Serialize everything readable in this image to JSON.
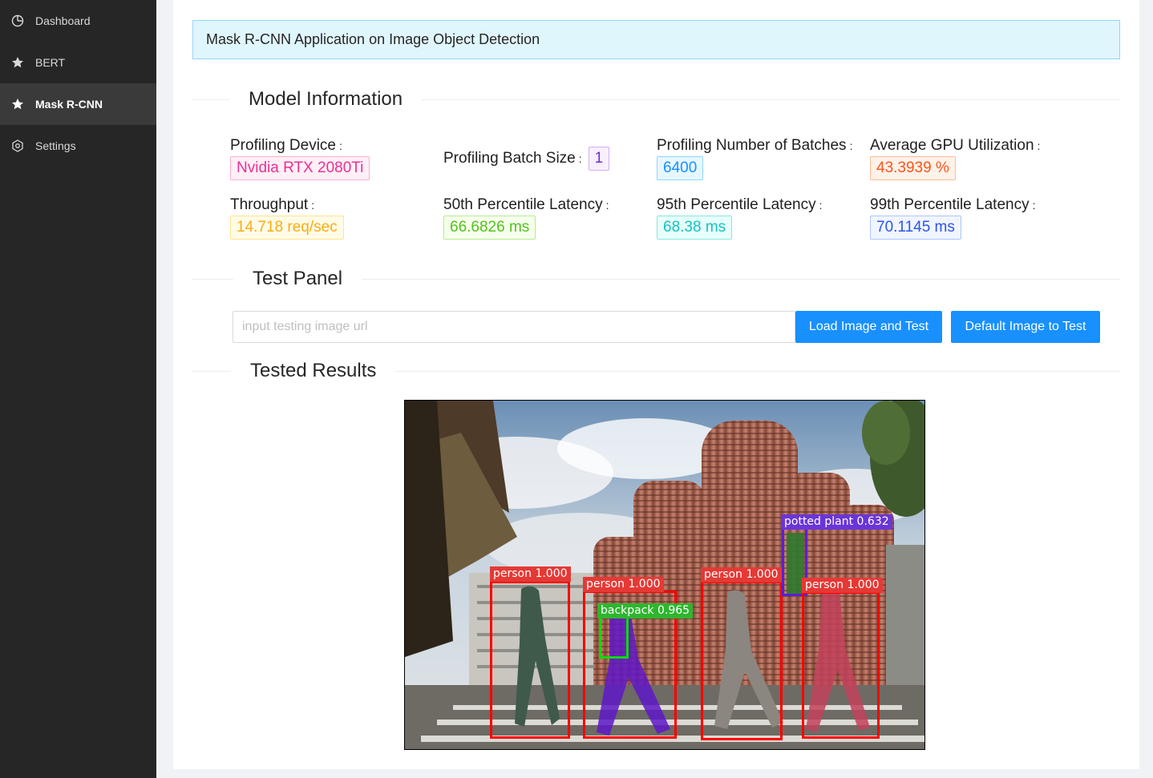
{
  "sidebar": {
    "items": [
      {
        "label": "Dashboard",
        "icon": "dashboard-icon"
      },
      {
        "label": "BERT",
        "icon": "star-icon"
      },
      {
        "label": "Mask R-CNN",
        "icon": "star-icon",
        "active": true
      },
      {
        "label": "Settings",
        "icon": "settings-icon"
      }
    ]
  },
  "banner": {
    "title": "Mask R-CNN Application on Image Object Detection"
  },
  "sections": {
    "model_info": "Model Information",
    "test_panel": "Test Panel",
    "tested_results": "Tested Results"
  },
  "model_info": {
    "profiling_device": {
      "label": "Profiling Device",
      "value": "Nvidia RTX 2080Ti"
    },
    "batch_size": {
      "label": "Profiling Batch Size",
      "value": "1"
    },
    "num_batches": {
      "label": "Profiling Number of Batches",
      "value": "6400"
    },
    "gpu_util": {
      "label": "Average GPU Utilization",
      "value": "43.3939 %"
    },
    "throughput": {
      "label": "Throughput",
      "value": "14.718 req/sec"
    },
    "p50": {
      "label": "50th Percentile Latency",
      "value": "66.6826 ms"
    },
    "p95": {
      "label": "95th Percentile Latency",
      "value": "68.38 ms"
    },
    "p99": {
      "label": "99th Percentile Latency",
      "value": "70.1145 ms"
    },
    "colon": ":"
  },
  "test_panel": {
    "url_placeholder": "input testing image url",
    "url_value": "",
    "load_button": "Load Image and Test",
    "default_button": "Default Image to Test"
  },
  "detections": [
    {
      "label": "person 1.000",
      "color": "#ff0000"
    },
    {
      "label": "person 1.000",
      "color": "#ff0000"
    },
    {
      "label": "backpack 0.965",
      "color": "#00c000"
    },
    {
      "label": "person 1.000",
      "color": "#ff0000"
    },
    {
      "label": "potted plant 0.632",
      "color": "#5a1fd6"
    },
    {
      "label": "person 1.000",
      "color": "#ff0000"
    }
  ],
  "colors": {
    "sidebar_bg": "#262626",
    "primary": "#1890ff",
    "banner_bg": "#e0f6fd"
  }
}
